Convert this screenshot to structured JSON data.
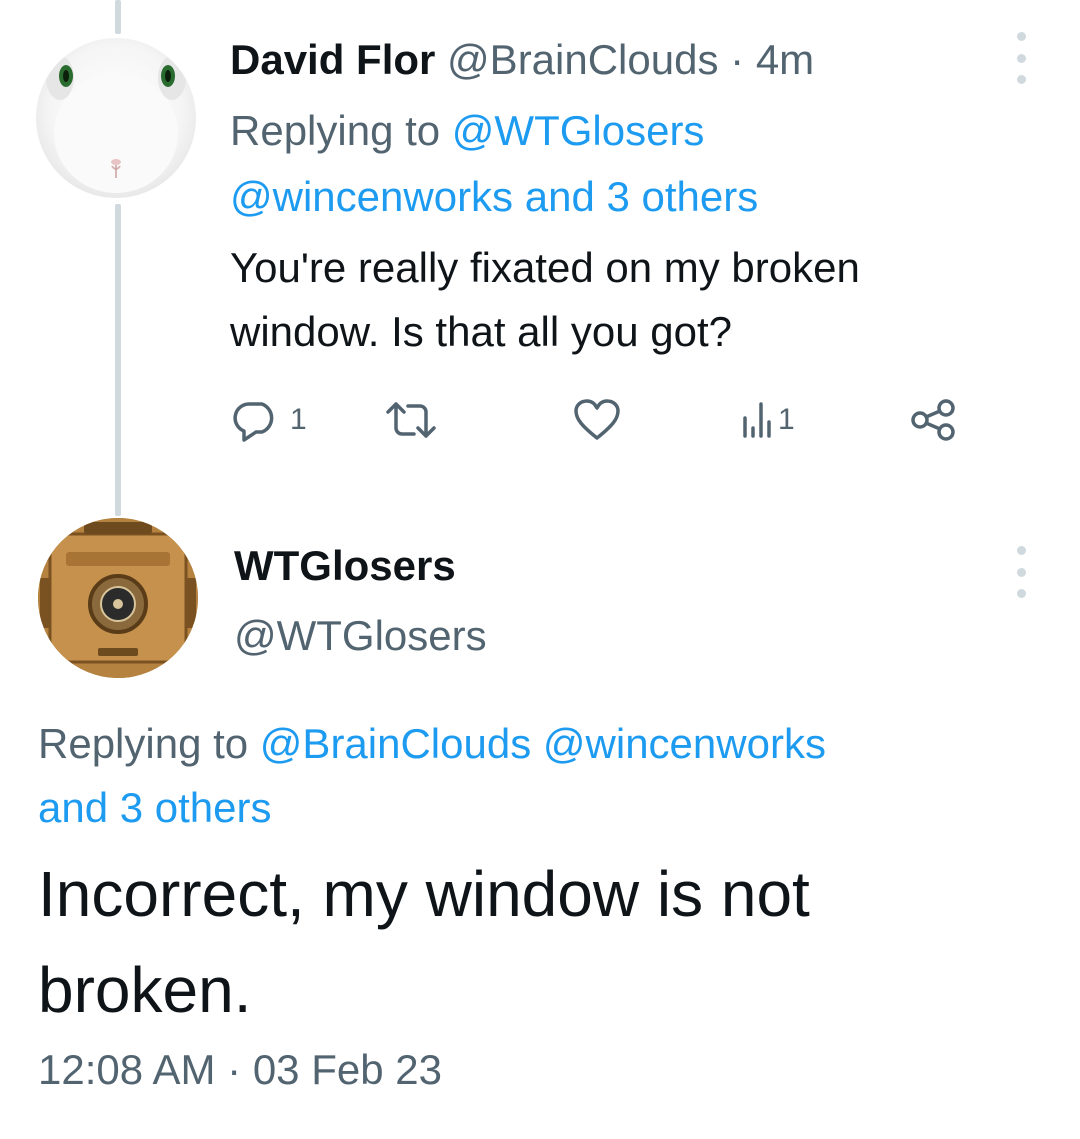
{
  "tweet_1": {
    "display_name": "David Flor",
    "handle": "@BrainClouds",
    "separator": "·",
    "time_ago": "4m",
    "replying_to_label": "Replying to",
    "replying_to_handle_1": "@WTGlosers",
    "replying_to_handle_2": "@wincenworks",
    "replying_to_and_others": "and 3 others",
    "text_line_1": "You're really fixated on my broken",
    "text_line_2": "window. Is that all you got?",
    "actions": {
      "reply_icon": "reply-icon",
      "reply_count": "1",
      "retweet_icon": "retweet-icon",
      "like_icon": "heart-icon",
      "views_icon": "views-icon",
      "views_count": "1",
      "share_icon": "share-icon"
    }
  },
  "tweet_2": {
    "display_name": "WTGlosers",
    "handle": "@WTGlosers",
    "replying_to_label": "Replying to",
    "replying_to_handle_1": "@BrainClouds",
    "replying_to_handle_2": "@wincenworks",
    "replying_to_and_others": "and 3 others",
    "text_line_1": "Incorrect, my window is not",
    "text_line_2": "broken.",
    "time": "12:08 AM",
    "separator": "·",
    "date": "03 Feb 23"
  },
  "colors": {
    "link": "#1d9bf0",
    "muted": "#536471",
    "text": "#0f1419",
    "thread_line": "#cfd9de"
  }
}
